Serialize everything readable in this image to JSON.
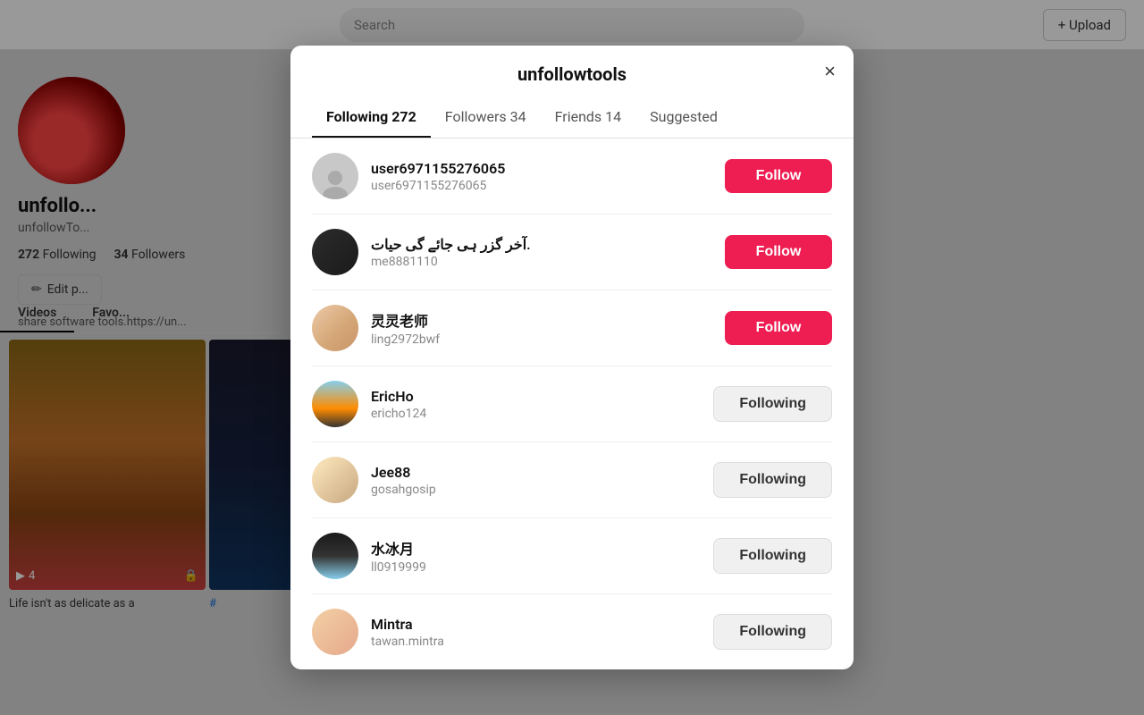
{
  "background": {
    "topbar": {
      "search_placeholder": "Search",
      "upload_label": "+ Upload"
    },
    "profile": {
      "username": "unfollo...",
      "handle": "unfollowTo...",
      "following_count": "272",
      "following_label": "Following",
      "followers_count": "34",
      "followers_label": "Followers",
      "edit_label": "Edit p...",
      "bio": "share software tools.https://un..."
    },
    "tabs": [
      {
        "label": "Videos",
        "active": true
      },
      {
        "label": "Favo...",
        "active": false
      }
    ],
    "video1": {
      "count": "4",
      "caption": "Life isn't as delicate as a"
    },
    "video2": {
      "caption": "#"
    }
  },
  "modal": {
    "title": "unfollowtools",
    "close_label": "×",
    "tabs": [
      {
        "label": "Following 272",
        "active": true
      },
      {
        "label": "Followers 34",
        "active": false
      },
      {
        "label": "Friends 14",
        "active": false
      },
      {
        "label": "Suggested",
        "active": false
      }
    ],
    "users": [
      {
        "id": 1,
        "name": "user6971155276065",
        "handle": "user6971155276065",
        "avatar_class": "avatar-circle-person",
        "status": "follow",
        "button_label": "Follow"
      },
      {
        "id": 2,
        "name": "آخر گزر ہی جائے گی حیات.",
        "handle": "me8881110",
        "avatar_class": "avatar-2",
        "status": "follow",
        "button_label": "Follow"
      },
      {
        "id": 3,
        "name": "灵灵老师",
        "handle": "ling2972bwf",
        "avatar_class": "avatar-3",
        "status": "follow",
        "button_label": "Follow"
      },
      {
        "id": 4,
        "name": "EricHo",
        "handle": "ericho124",
        "avatar_class": "avatar-4",
        "status": "following",
        "button_label": "Following"
      },
      {
        "id": 5,
        "name": "Jee88",
        "handle": "gosahgosip",
        "avatar_class": "avatar-5",
        "status": "following",
        "button_label": "Following"
      },
      {
        "id": 6,
        "name": "水冰月",
        "handle": "ll0919999",
        "avatar_class": "avatar-6",
        "status": "following",
        "button_label": "Following"
      },
      {
        "id": 7,
        "name": "Mintra",
        "handle": "tawan.mintra",
        "avatar_class": "avatar-7",
        "status": "following",
        "button_label": "Following"
      }
    ]
  }
}
